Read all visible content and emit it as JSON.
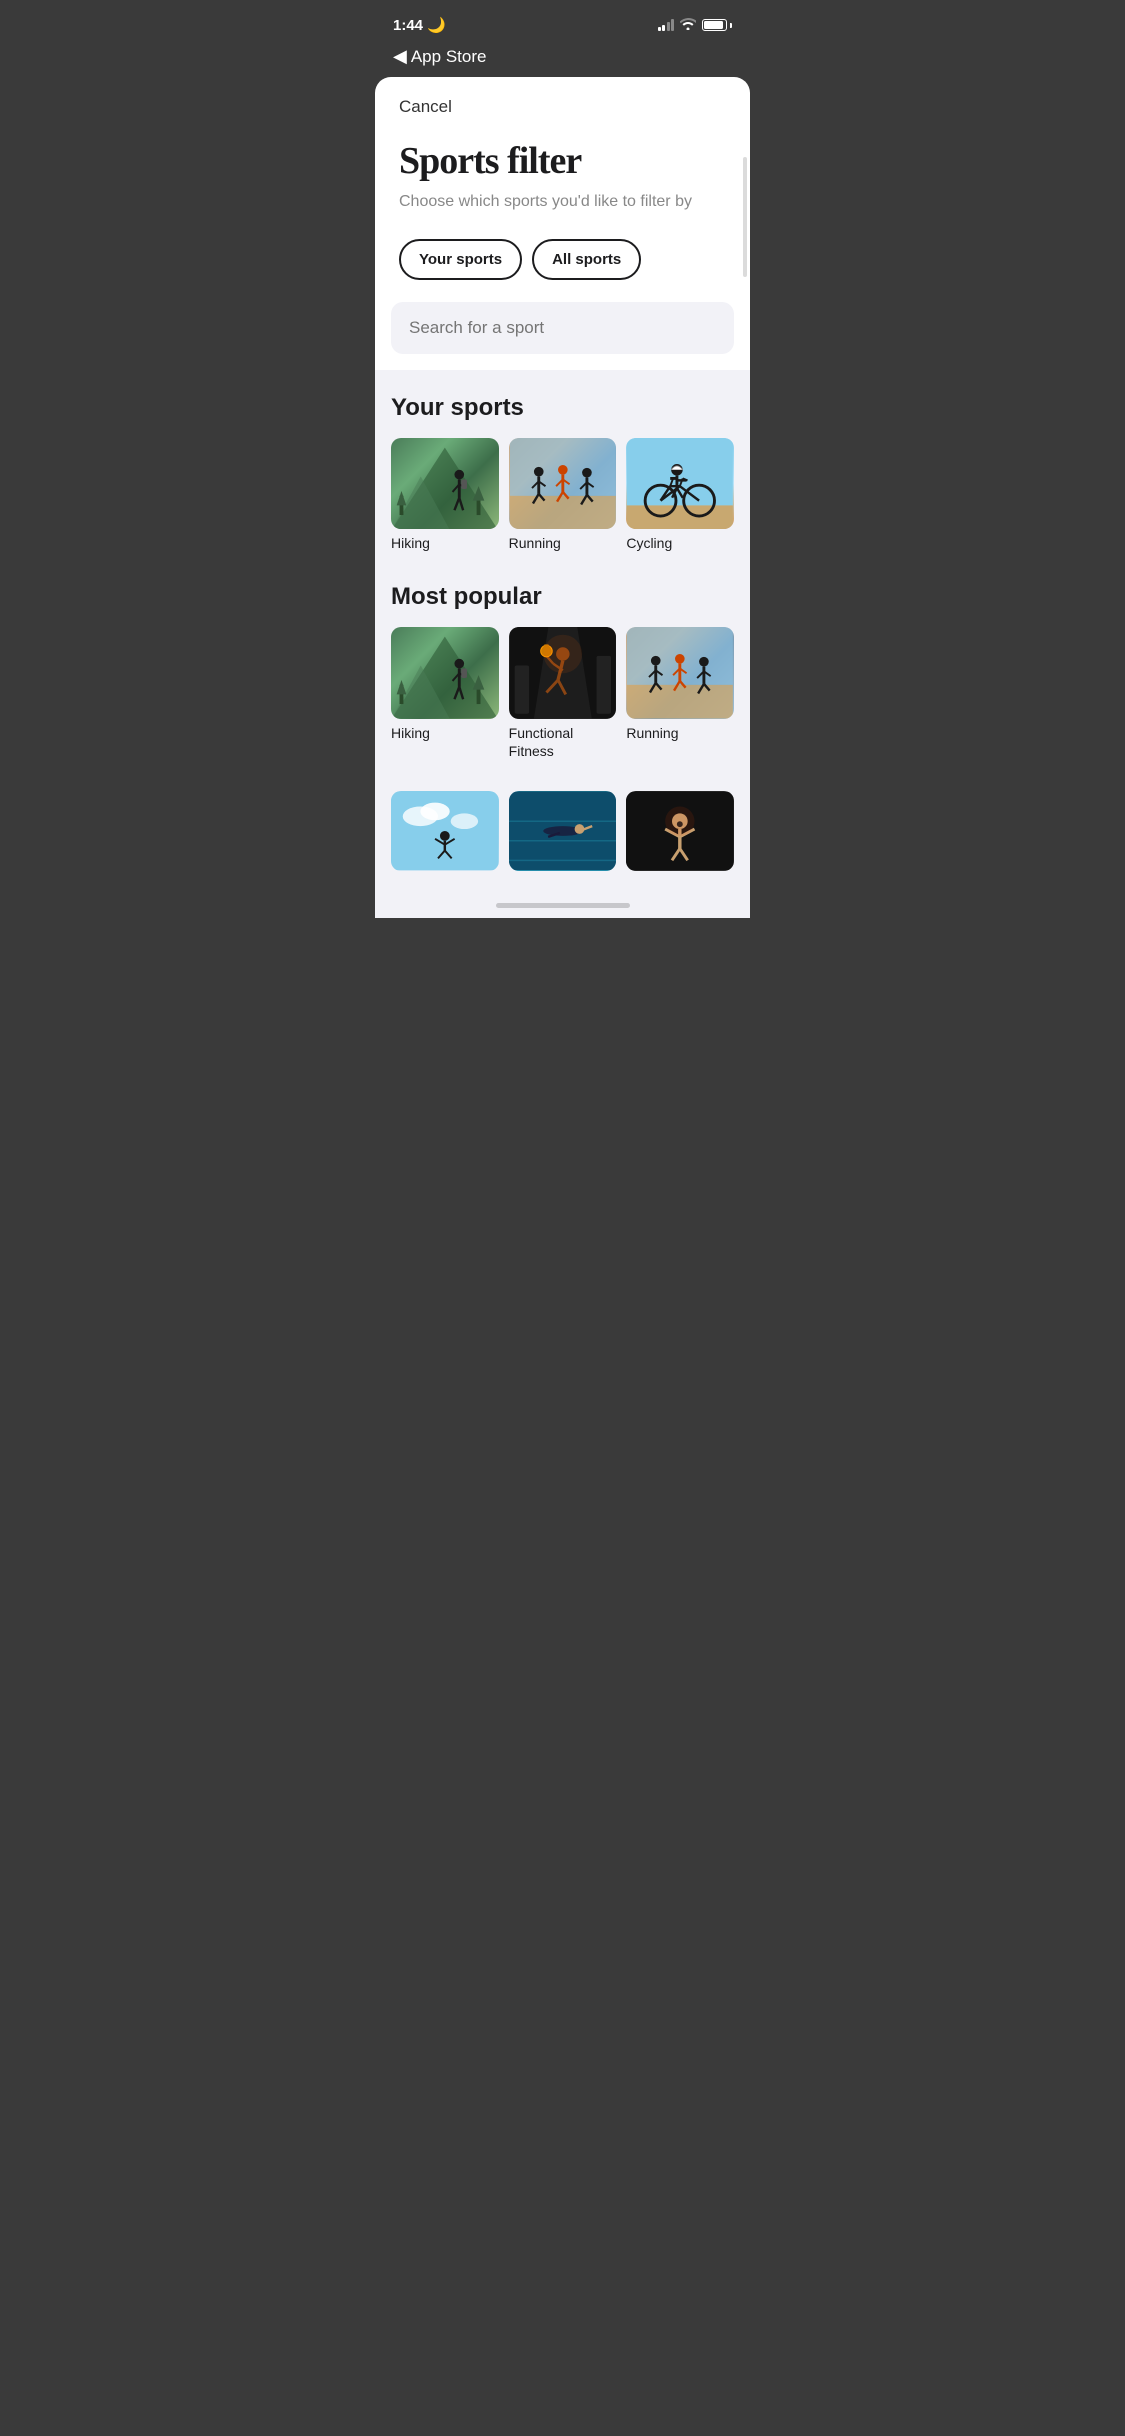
{
  "statusBar": {
    "time": "1:44",
    "moonIcon": "🌙"
  },
  "nav": {
    "backLabel": "App Store"
  },
  "sheet": {
    "cancelLabel": "Cancel",
    "title": "Sports filter",
    "subtitle": "Choose which sports you'd like to filter by",
    "tabs": [
      {
        "id": "your-sports",
        "label": "Your sports"
      },
      {
        "id": "all-sports",
        "label": "All sports"
      }
    ],
    "searchPlaceholder": "Search for a sport"
  },
  "yourSports": {
    "sectionTitle": "Your sports",
    "items": [
      {
        "id": "hiking-your",
        "label": "Hiking",
        "imageType": "hiking"
      },
      {
        "id": "running-your",
        "label": "Running",
        "imageType": "running"
      },
      {
        "id": "cycling-your",
        "label": "Cycling",
        "imageType": "cycling"
      }
    ]
  },
  "mostPopular": {
    "sectionTitle": "Most popular",
    "items": [
      {
        "id": "hiking-popular",
        "label": "Hiking",
        "imageType": "hiking"
      },
      {
        "id": "functional-popular",
        "label": "Functional Fitness",
        "imageType": "functional"
      },
      {
        "id": "running-popular",
        "label": "Running",
        "imageType": "running"
      }
    ]
  },
  "bottomRow": {
    "items": [
      {
        "id": "sky-sport",
        "label": "",
        "imageType": "sky"
      },
      {
        "id": "pool-sport",
        "label": "",
        "imageType": "pool"
      },
      {
        "id": "dark-sport",
        "label": "",
        "imageType": "dark"
      }
    ]
  }
}
